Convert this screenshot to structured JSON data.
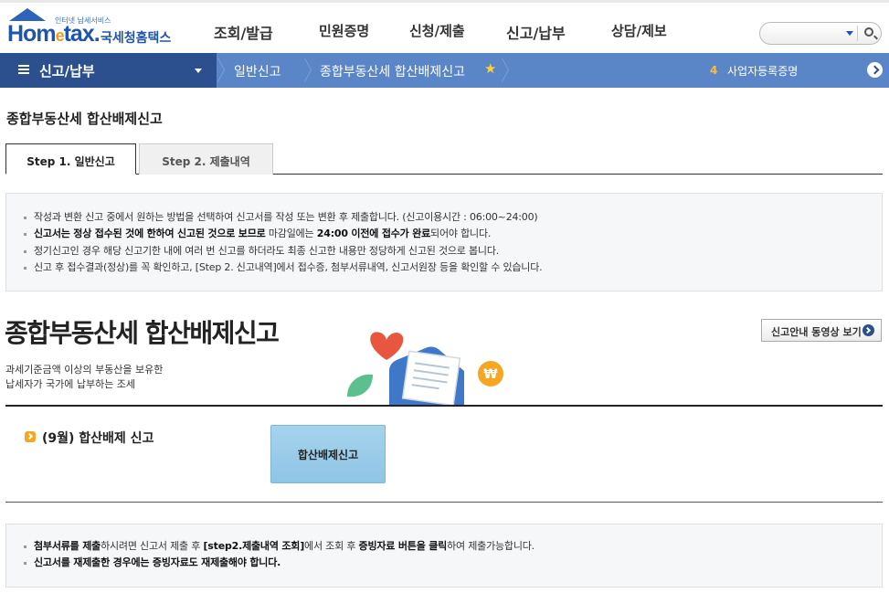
{
  "header": {
    "logo_tagline": "인터넷 납세서비스",
    "logo_brand_left": "Hom",
    "logo_brand_e": "e",
    "logo_brand_right": "tax.",
    "logo_brand_kr": "국세청홈택스",
    "nav": [
      "조회/발급",
      "민원증명",
      "신청/제출",
      "신고/납부",
      "상담/제보"
    ],
    "search_placeholder": ""
  },
  "sub_bar": {
    "menu_label": "신고/납부",
    "breadcrumbs": [
      "일반신고",
      "종합부동산세 합산배제신고"
    ],
    "recent_count": "4",
    "recent_label": "사업자등록증명",
    "colors": {
      "menu_bg": "#2c4f8e",
      "bar_bg": "#5a86c8",
      "star": "#ffd233"
    }
  },
  "page": {
    "title": "종합부동산세 합산배제신고",
    "tabs": [
      {
        "label": "Step 1. 일반신고",
        "active": true
      },
      {
        "label": "Step 2. 제출내역",
        "active": false
      }
    ],
    "notices": [
      {
        "text": "작성과 변환 신고 중에서 원하는 방법을 선택하여 신고서를 작성 또는 변환 후 제출합니다. (신고이용시간 : 06:00~24:00)"
      },
      {
        "b1": "신고서는 정상 접수된 것에 한하여 신고된 것으로 보므로",
        "t1": " 마감일에는 ",
        "b2": "24:00 이전에 접수가 완료",
        "t2": "되어야 합니다."
      },
      {
        "text": "정기신고인 경우 해당 신고기한 내에 여러 번 신고를 하더라도 최종 신고한 내용만 정당하게 신고된 것으로 봅니다."
      },
      {
        "text": "신고 후 접수결과(정상)를 꼭 확인하고, [Step 2. 신고내역]에서 접수증, 첨부서류내역, 신고서원장 등을 확인할 수 있습니다."
      }
    ],
    "hero": {
      "title": "종합부동산세 합산배제신고",
      "desc_1": "과세기준금액 이상의 부동산을 보유한",
      "desc_2": "납세자가 국가에 납부하는 조세",
      "video_button": "신고안내 동영상 보기"
    },
    "section": {
      "label": "(9월) 합산배제 신고",
      "button": "합산배제신고"
    },
    "bottom_notices": [
      {
        "b1": "첨부서류를 제출",
        "t1": "하시려면 신고서 제출 후 ",
        "b2": "[step2.제출내역 조회]",
        "t2": "에서 조회 후 ",
        "b3": "증빙자료 버튼을 클릭",
        "t3": "하여 제출가능합니다."
      },
      {
        "b1": "신고서를 재제출한 경우에는 증빙자료도 재제출해야 합니다."
      }
    ]
  }
}
